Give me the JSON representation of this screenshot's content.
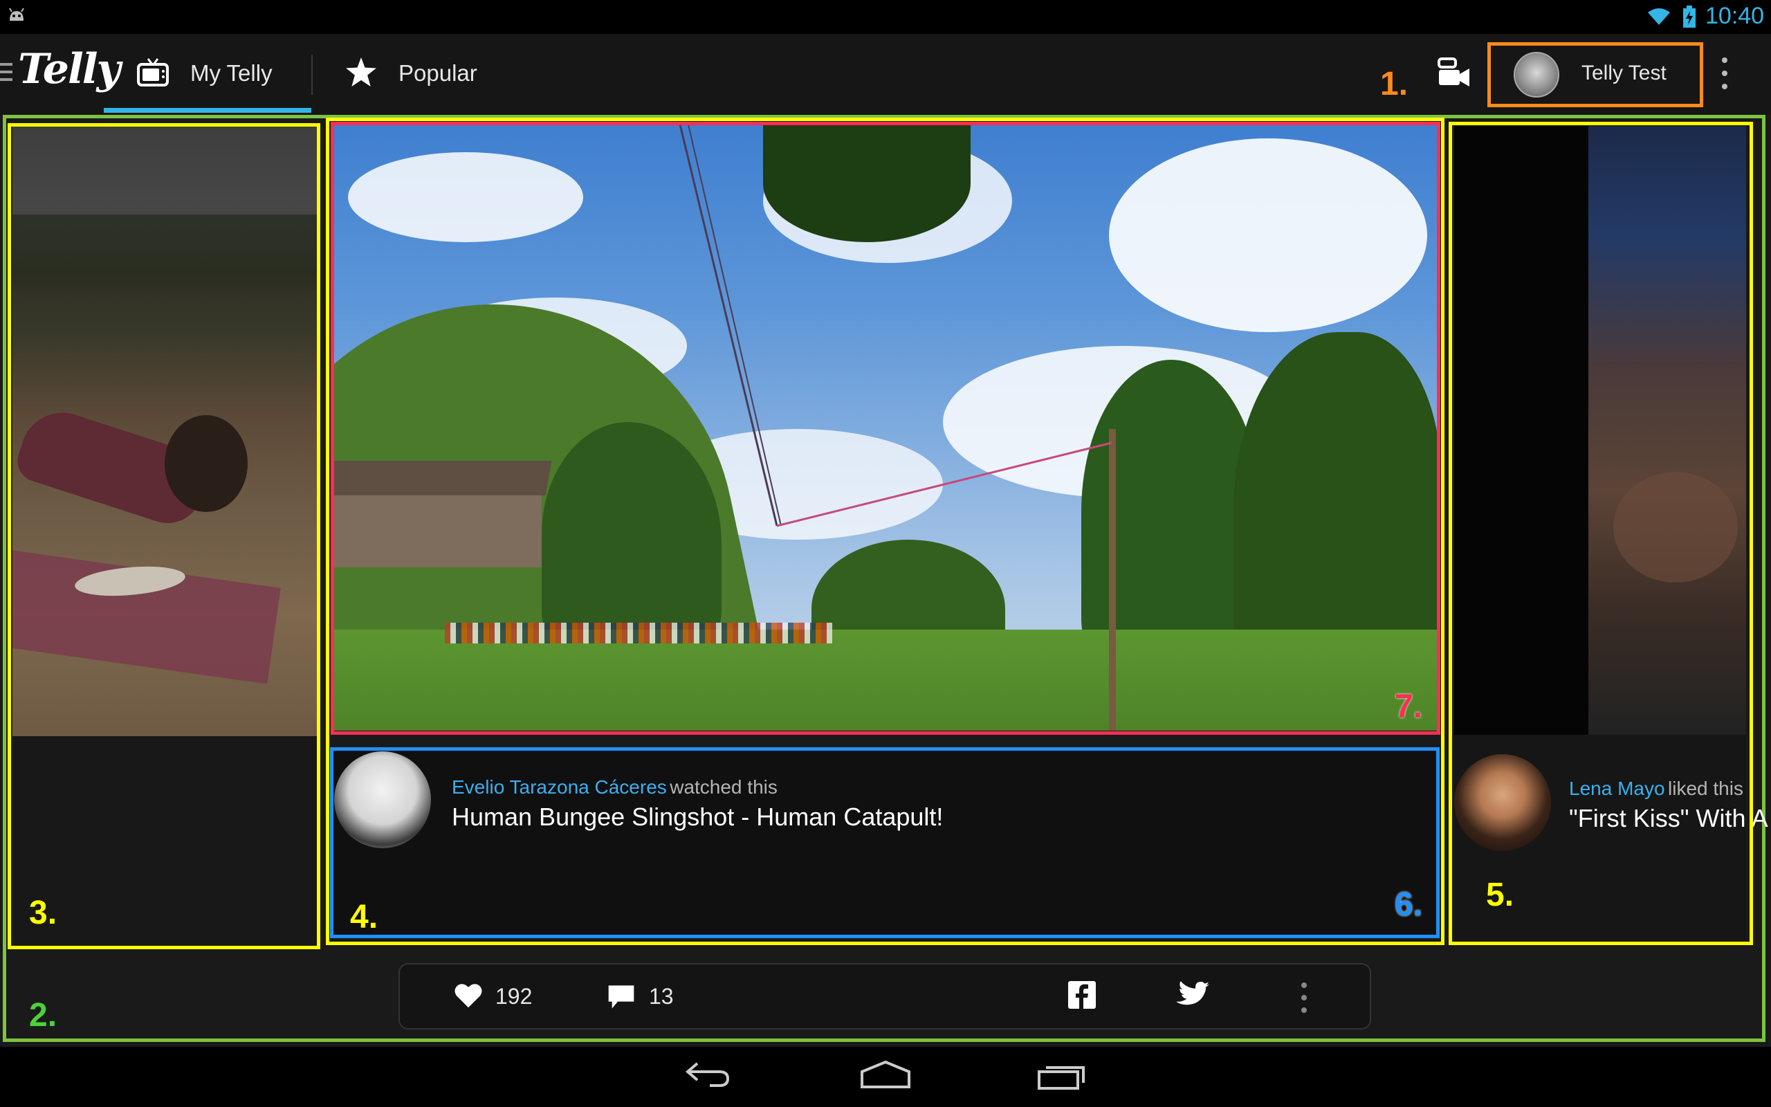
{
  "status_bar": {
    "time": "10:40",
    "icons": [
      "android-debug-icon",
      "wifi-icon",
      "battery-charging-icon"
    ]
  },
  "app_bar": {
    "logo": "Telly",
    "tabs": [
      {
        "label": "My Telly",
        "icon": "tv-icon",
        "selected": true
      },
      {
        "label": "Popular",
        "icon": "star-icon",
        "selected": false
      }
    ],
    "record_icon": "video-camera-icon",
    "account_name": "Telly Test",
    "overflow_icon": "more-vert-icon"
  },
  "cards": {
    "center": {
      "user": "Evelio Tarazona Cáceres",
      "action": "watched this",
      "title": "Human Bungee Slingshot - Human Catapult!"
    },
    "right": {
      "user": "Lena Mayo",
      "action": "liked this",
      "title": "\"First Kiss\" With A"
    }
  },
  "actions": {
    "likes": "192",
    "comments": "13",
    "share_icons": [
      "facebook-icon",
      "twitter-icon"
    ],
    "overflow_icon": "more-vert-icon"
  },
  "annotations": {
    "n1": "1.",
    "n2": "2.",
    "n3": "3.",
    "n4": "4.",
    "n5": "5.",
    "n6": "6.",
    "n7": "7."
  },
  "annotation_colors": {
    "orange": "#ff8a1d",
    "green": "#7dc242",
    "yellow": "#ffff00",
    "red": "#ff2d55",
    "blue": "#1e90ff"
  },
  "colors": {
    "accent": "#33b5e5",
    "link": "#3ab0f0",
    "background": "#1a1a1a"
  }
}
